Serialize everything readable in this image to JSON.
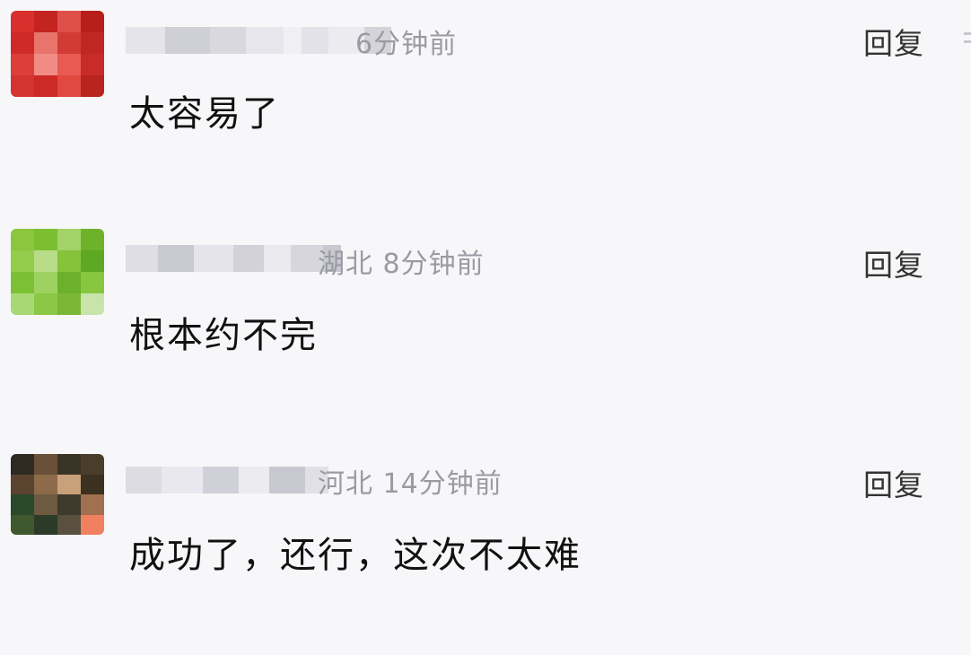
{
  "comments": [
    {
      "location": "",
      "time": "6分钟前",
      "reply_label": "回复",
      "text": "太容易了",
      "avatar_colors": [
        "#d8302c",
        "#c42420",
        "#e0504a",
        "#b81e1a",
        "#cf2a26",
        "#e8746c",
        "#d23a34",
        "#c02622",
        "#dc3e38",
        "#f08c84",
        "#e85a52",
        "#c82c28",
        "#d4342e",
        "#cc2a26",
        "#e04840",
        "#b82420"
      ]
    },
    {
      "location": "湖北",
      "time": "8分钟前",
      "reply_label": "回复",
      "text": "根本约不完",
      "avatar_colors": [
        "#8cc63e",
        "#7bbf30",
        "#a2d46a",
        "#6eb22a",
        "#94cc4c",
        "#b8dc88",
        "#86c23a",
        "#5ea824",
        "#7cc034",
        "#9ed260",
        "#6cb02c",
        "#88c640",
        "#a8d874",
        "#8ac846",
        "#7ab836",
        "#c8e4a8"
      ]
    },
    {
      "location": "河北",
      "time": "14分钟前",
      "reply_label": "回复",
      "text": "成功了，还行，这次不太难",
      "avatar_colors": [
        "#2e2a22",
        "#6a5038",
        "#3a3426",
        "#4a3e2a",
        "#5a4430",
        "#8c6a4a",
        "#c8a07a",
        "#3c3020",
        "#2a4a2a",
        "#6e5a40",
        "#3e3a2c",
        "#a07050",
        "#40582e",
        "#2c3a28",
        "#5a5040",
        "#f08060"
      ]
    }
  ]
}
